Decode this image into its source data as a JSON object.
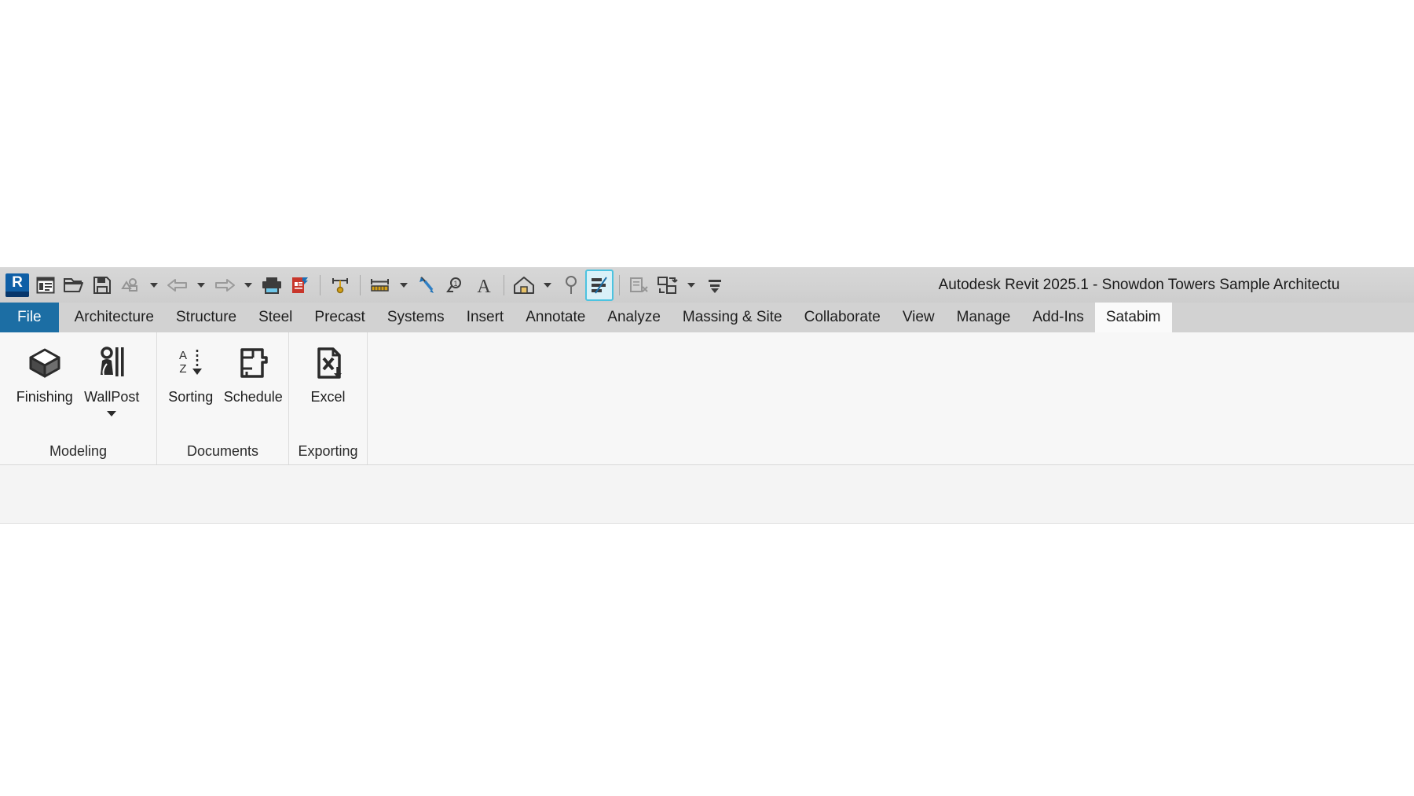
{
  "window": {
    "title": "Autodesk Revit 2025.1 - Snowdon Towers Sample Architectu",
    "app_logo_letter": "R"
  },
  "colors": {
    "file_tab_blue": "#1c6ea4",
    "revit_logo_blue": "#0f5fa6",
    "revit_logo_dark": "#06366b",
    "toolbar_gray": "#d2d2d2",
    "ribbon_bg": "#f7f7f7",
    "active_tab_bg": "#fafafa",
    "excel_red": "#c8362b",
    "measure_gold": "#d4a017",
    "accent_cyan": "#4cc3e0"
  },
  "quick_access_toolbar": {
    "items": [
      {
        "name": "revit-home-logo",
        "icon": "revit-r-logo",
        "label": "Revit Home"
      },
      {
        "name": "new-project",
        "icon": "new-project-icon",
        "label": "New"
      },
      {
        "name": "open-project",
        "icon": "open-folder-icon",
        "label": "Open"
      },
      {
        "name": "save-project",
        "icon": "save-floppy-icon",
        "label": "Save"
      },
      {
        "name": "sync-with-central",
        "icon": "sync-cloud-icon",
        "label": "Synchronize with Central",
        "disabled": true
      },
      {
        "name": "sync-dropdown",
        "icon": "caret-down-icon",
        "label": "Synchronize options"
      },
      {
        "name": "undo",
        "icon": "undo-arrow-icon",
        "label": "Undo",
        "disabled": true
      },
      {
        "name": "undo-dropdown",
        "icon": "caret-down-icon",
        "label": "Undo list"
      },
      {
        "name": "redo",
        "icon": "redo-arrow-icon",
        "label": "Redo",
        "disabled": true
      },
      {
        "name": "redo-dropdown",
        "icon": "caret-down-icon",
        "label": "Redo list"
      },
      {
        "name": "print",
        "icon": "printer-icon",
        "label": "Print"
      },
      {
        "name": "close-inactive-views",
        "icon": "close-views-icon",
        "label": "Close Inactive Views"
      },
      {
        "name": "measure-between-references",
        "icon": "measure-references-icon",
        "label": "Measure Between Two References"
      },
      {
        "name": "aligned-dimension",
        "icon": "aligned-dimension-icon",
        "label": "Aligned Dimension"
      },
      {
        "name": "dimension-dropdown",
        "icon": "caret-down-icon",
        "label": "Dimension types"
      },
      {
        "name": "tag-by-category",
        "icon": "tag-icon",
        "label": "Tag by Category"
      },
      {
        "name": "spot-elevation",
        "icon": "spot-elevation-icon",
        "label": "Spot Elevation"
      },
      {
        "name": "text-note",
        "icon": "text-a-icon",
        "label": "Text"
      },
      {
        "name": "default-3d-view",
        "icon": "house-3d-icon",
        "label": "Default 3D View"
      },
      {
        "name": "view-dropdown",
        "icon": "caret-down-icon",
        "label": "3D view options"
      },
      {
        "name": "section-view",
        "icon": "section-icon",
        "label": "Section"
      },
      {
        "name": "thin-lines",
        "icon": "thin-lines-icon",
        "label": "Thin Lines",
        "active": true
      },
      {
        "name": "close-hidden-windows",
        "icon": "close-window-icon",
        "label": "Close Hidden Windows",
        "disabled": true
      },
      {
        "name": "switch-windows",
        "icon": "switch-windows-icon",
        "label": "Switch Windows"
      },
      {
        "name": "switch-windows-dropdown",
        "icon": "caret-down-icon",
        "label": "Switch Windows list"
      },
      {
        "name": "customize-qat",
        "icon": "qat-overflow-icon",
        "label": "Customize Quick Access Toolbar"
      }
    ]
  },
  "ribbon": {
    "tabs": [
      {
        "label": "File",
        "style": "file"
      },
      {
        "label": "Architecture",
        "style": "normal"
      },
      {
        "label": "Structure",
        "style": "normal"
      },
      {
        "label": "Steel",
        "style": "normal"
      },
      {
        "label": "Precast",
        "style": "normal"
      },
      {
        "label": "Systems",
        "style": "normal"
      },
      {
        "label": "Insert",
        "style": "normal"
      },
      {
        "label": "Annotate",
        "style": "normal"
      },
      {
        "label": "Analyze",
        "style": "normal"
      },
      {
        "label": "Massing & Site",
        "style": "normal"
      },
      {
        "label": "Collaborate",
        "style": "normal"
      },
      {
        "label": "View",
        "style": "normal"
      },
      {
        "label": "Manage",
        "style": "normal"
      },
      {
        "label": "Add-Ins",
        "style": "normal"
      },
      {
        "label": "Satabim",
        "style": "active"
      }
    ],
    "panels": [
      {
        "title": "Modeling",
        "buttons": [
          {
            "label": "Finishing",
            "icon": "cube-3d-icon",
            "has_dropdown": false
          },
          {
            "label": "WallPost",
            "icon": "wall-post-icon",
            "has_dropdown": true
          }
        ]
      },
      {
        "title": "Documents",
        "buttons": [
          {
            "label": "Sorting",
            "icon": "sort-az-icon",
            "has_dropdown": false
          },
          {
            "label": "Schedule",
            "icon": "floor-plan-icon",
            "has_dropdown": false
          }
        ]
      },
      {
        "title": "Exporting",
        "buttons": [
          {
            "label": "Excel",
            "icon": "excel-export-icon",
            "has_dropdown": false
          }
        ]
      }
    ]
  }
}
